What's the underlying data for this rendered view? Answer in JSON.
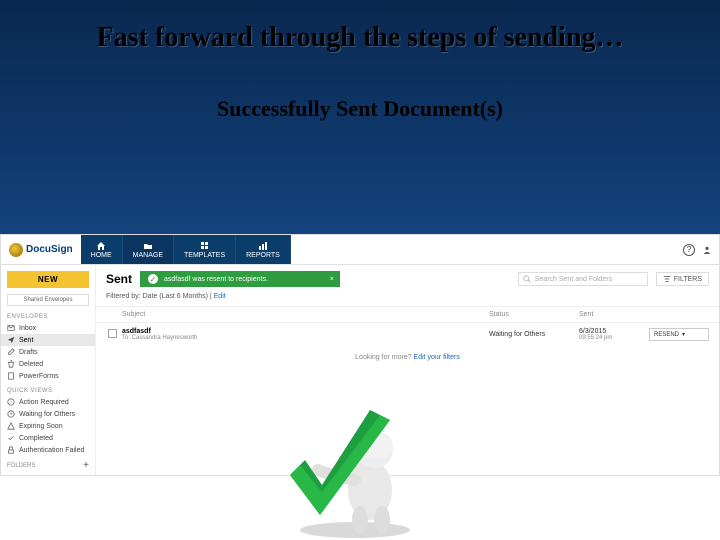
{
  "slide": {
    "title": "Fast forward through the steps of sending…",
    "subtitle": "Successfully Sent Document(s)"
  },
  "brand": {
    "name": "DocuSign"
  },
  "nav": {
    "home": "HOME",
    "manage": "MANAGE",
    "templates": "TEMPLATES",
    "reports": "REPORTS"
  },
  "sidebar": {
    "new_button": "NEW",
    "shared_filter": "Shared Envelopes",
    "envelopes_title": "ENVELOPES",
    "envelopes": [
      {
        "label": "Inbox"
      },
      {
        "label": "Sent"
      },
      {
        "label": "Drafts"
      },
      {
        "label": "Deleted"
      },
      {
        "label": "PowerForms"
      }
    ],
    "quickviews_title": "QUICK VIEWS",
    "quickviews": [
      {
        "label": "Action Required"
      },
      {
        "label": "Waiting for Others"
      },
      {
        "label": "Expiring Soon"
      },
      {
        "label": "Completed"
      },
      {
        "label": "Authentication Failed"
      }
    ],
    "folders_title": "FOLDERS"
  },
  "content": {
    "page_title": "Sent",
    "toast_message": "asdfasdf was resent to recipients.",
    "search_placeholder": "Search Sent and Folders",
    "filters_button": "FILTERS",
    "filter_line_prefix": "Filtered by: Date (Last 6 Months)  |  ",
    "filter_line_edit": "Edit",
    "columns": {
      "subject": "Subject",
      "status": "Status",
      "sent": "Sent"
    },
    "rows": [
      {
        "subject": "asdfasdf",
        "to": "To: Cassandra Haynesworth",
        "status": "Waiting for Others",
        "sent_date": "6/3/2015",
        "sent_time": "09:55:24 pm",
        "action": "RESEND"
      }
    ],
    "looking_prefix": "Looking for more?  ",
    "looking_link": "Edit your filters"
  }
}
